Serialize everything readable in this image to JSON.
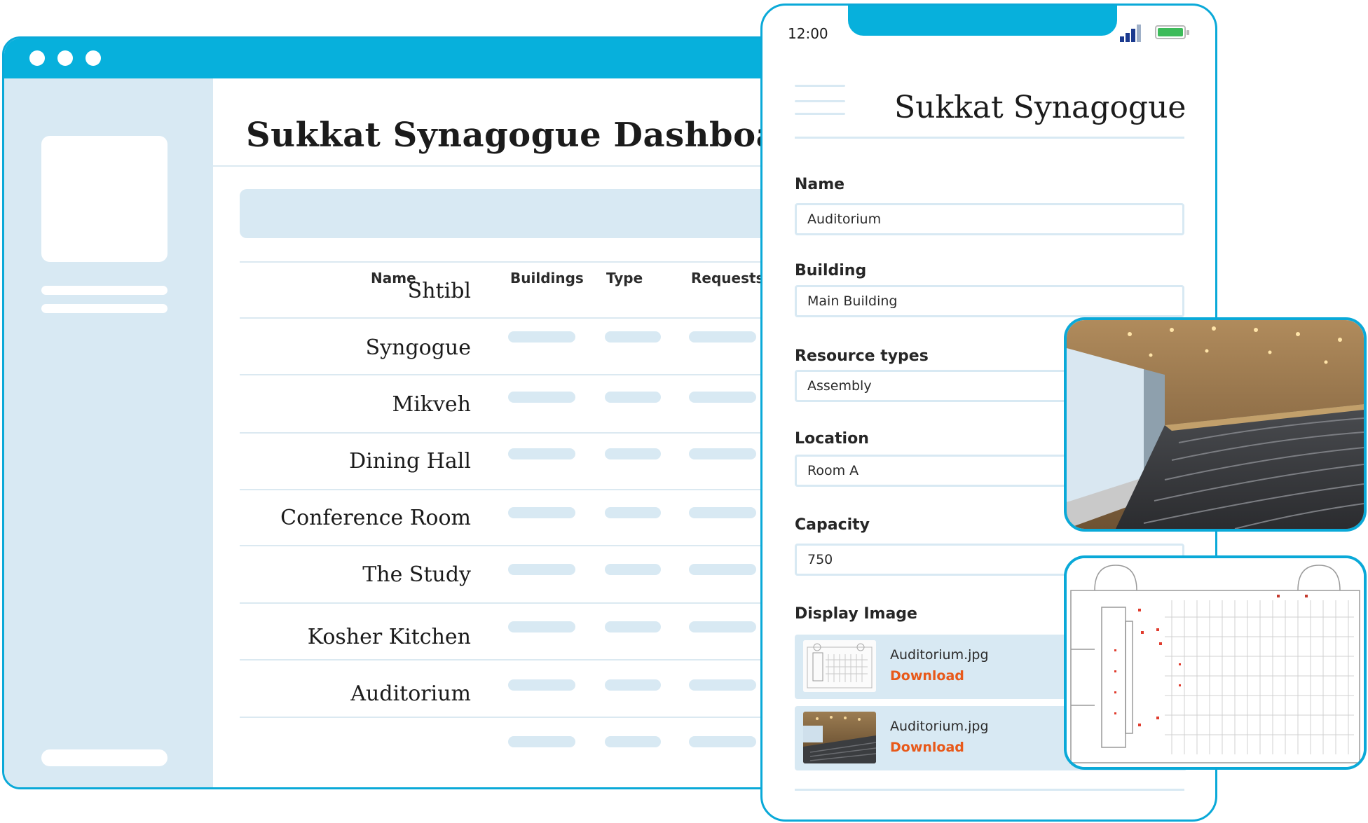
{
  "dashboard": {
    "title": "Sukkat Synagogue Dashboard",
    "columns": [
      "Name",
      "Buildings",
      "Type",
      "Requests"
    ],
    "rows": [
      "Shtibl",
      "Syngogue",
      "Mikveh",
      "Dining Hall",
      "Conference Room",
      "The Study",
      "Kosher Kitchen",
      "Auditorium"
    ]
  },
  "phone": {
    "time": "12:00",
    "title": "Sukkat Synagogue",
    "fields": [
      {
        "label": "Name",
        "value": "Auditorium"
      },
      {
        "label": "Building",
        "value": "Main Building"
      },
      {
        "label": "Resource types",
        "value": "Assembly"
      },
      {
        "label": "Location",
        "value": "Room A"
      },
      {
        "label": "Capacity",
        "value": "750"
      }
    ],
    "display_image_label": "Display Image",
    "files": [
      {
        "name": "Auditorium.jpg",
        "action": "Download",
        "thumb": "floor-plan"
      },
      {
        "name": "Auditorium.jpg",
        "action": "Download",
        "thumb": "auditorium-photo"
      }
    ]
  },
  "colors": {
    "accent": "#07b0dc",
    "panel": "#d8e9f3",
    "download": "#e8591a"
  }
}
